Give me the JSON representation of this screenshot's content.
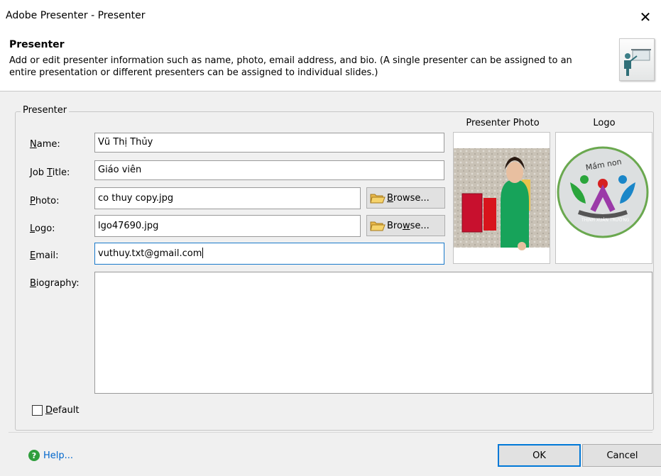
{
  "window": {
    "title": "Adobe Presenter - Presenter",
    "close_glyph": "✕"
  },
  "header": {
    "title": "Presenter",
    "description": "Add or edit presenter information such as name, photo, email address, and bio. (A single presenter can be assigned to an entire presentation or different presenters can be assigned to individual slides.)",
    "icon": "presenter-board-icon"
  },
  "form": {
    "group_label": "Presenter",
    "name_label_u": "N",
    "name_label_rest": "ame:",
    "name_value": "Vũ Thị Thủy",
    "job_label_pre": "Job ",
    "job_label_u": "T",
    "job_label_rest": "itle:",
    "job_value": "Giáo viên",
    "photo_label_u": "P",
    "photo_label_rest": "hoto:",
    "photo_value": "co thuy copy.jpg",
    "logo_label_u": "L",
    "logo_label_rest": "ogo:",
    "logo_value": "lgo47690.jpg",
    "email_label_u": "E",
    "email_label_rest": "mail:",
    "email_value": "vuthuy.txt@gmail.com",
    "bio_label_u": "B",
    "bio_label_rest": "iography:",
    "bio_value": "",
    "browse_photo_u": "B",
    "browse_photo_rest": "rowse...",
    "browse_logo_pre": "Bro",
    "browse_logo_u": "w",
    "browse_logo_rest": "se...",
    "default_u": "D",
    "default_rest": "efault",
    "default_checked": false
  },
  "panels": {
    "photo_label": "Presenter Photo",
    "logo_label": "Logo",
    "logo_text_top": "Mầm non",
    "logo_text_bottom": "THỊNH XUÂN TRƯỜNG"
  },
  "footer": {
    "help_label": "Help...",
    "ok_label": "OK",
    "cancel_label": "Cancel"
  },
  "colors": {
    "accent": "#0078d7",
    "help_icon": "#2f9e3c",
    "link": "#0066cc"
  }
}
